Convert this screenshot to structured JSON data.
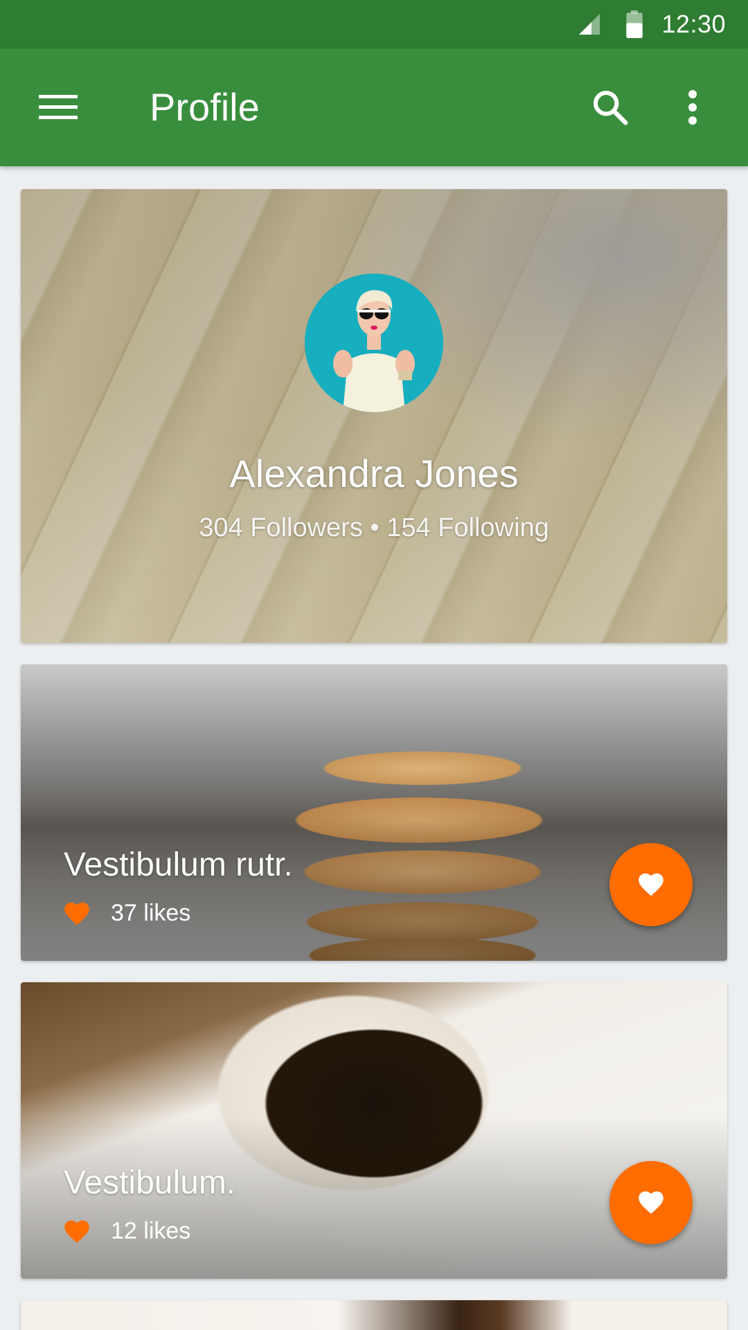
{
  "status_bar": {
    "time": "12:30",
    "icons": [
      "signal-icon",
      "battery-icon"
    ]
  },
  "app_bar": {
    "title": "Profile",
    "icons": [
      "menu-icon",
      "search-icon",
      "more-vert-icon"
    ]
  },
  "profile": {
    "name": "Alexandra Jones",
    "stats": "304 Followers • 154 Following"
  },
  "posts": [
    {
      "title": "Vestibulum rutr.",
      "likes": "37 likes",
      "icon": "heart-icon"
    },
    {
      "title": "Vestibulum.",
      "likes": "12 likes",
      "icon": "heart-icon"
    }
  ],
  "colors": {
    "status_bar": "#2e7d32",
    "app_bar": "#388e3c",
    "accent": "#ff6d00",
    "background": "#eceff1"
  }
}
